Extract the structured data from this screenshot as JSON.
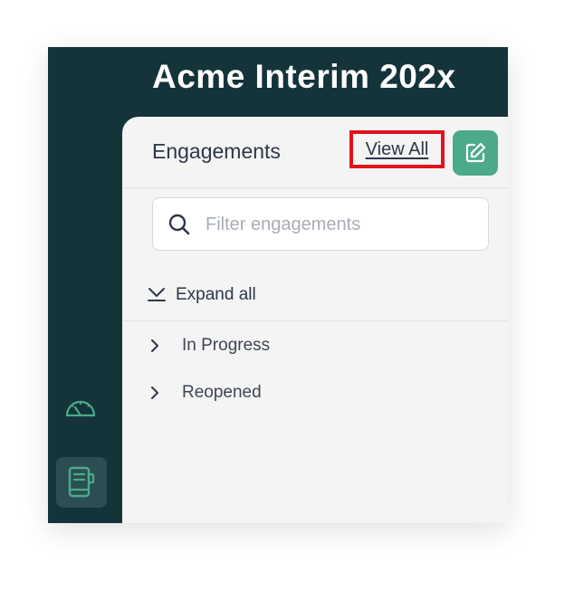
{
  "app": {
    "title": "Acme Interim 202x"
  },
  "sidebar": {
    "items": [
      {
        "icon": "dashboard-gauge-icon",
        "active": false
      },
      {
        "icon": "engagements-book-icon",
        "active": true
      }
    ]
  },
  "panel": {
    "title": "Engagements",
    "view_all_label": "View All",
    "edit_icon": "edit-icon",
    "search": {
      "placeholder": "Filter engagements",
      "value": ""
    },
    "expand_all_label": "Expand all",
    "groups": [
      {
        "label": "In Progress"
      },
      {
        "label": "Reopened"
      }
    ]
  },
  "colors": {
    "sidebar_bg": "#14343a",
    "panel_bg": "#f4f4f4",
    "accent": "#4caa8b",
    "highlight": "#e0141e"
  }
}
